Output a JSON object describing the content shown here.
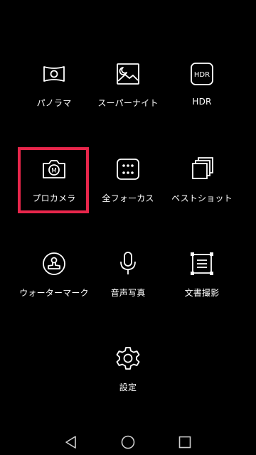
{
  "modes": [
    {
      "label": "パノラマ",
      "icon": "panorama-icon"
    },
    {
      "label": "スーパーナイト",
      "icon": "super-night-icon"
    },
    {
      "label": "HDR",
      "icon": "hdr-icon"
    },
    {
      "label": "プロカメラ",
      "icon": "pro-camera-icon",
      "selected": true
    },
    {
      "label": "全フォーカス",
      "icon": "all-focus-icon"
    },
    {
      "label": "ベストショット",
      "icon": "best-shot-icon"
    },
    {
      "label": "ウォーターマーク",
      "icon": "watermark-icon"
    },
    {
      "label": "音声写真",
      "icon": "audio-photo-icon"
    },
    {
      "label": "文書撮影",
      "icon": "document-scan-icon"
    },
    {
      "label": "設定",
      "icon": "settings-icon"
    }
  ],
  "hdr_icon_text": "HDR",
  "pro_icon_text": "M",
  "navigation": {
    "back": "back-icon",
    "home": "home-icon",
    "recents": "recents-icon"
  },
  "colors": {
    "background": "#000000",
    "foreground": "#ffffff",
    "selection": "#e8264b"
  }
}
